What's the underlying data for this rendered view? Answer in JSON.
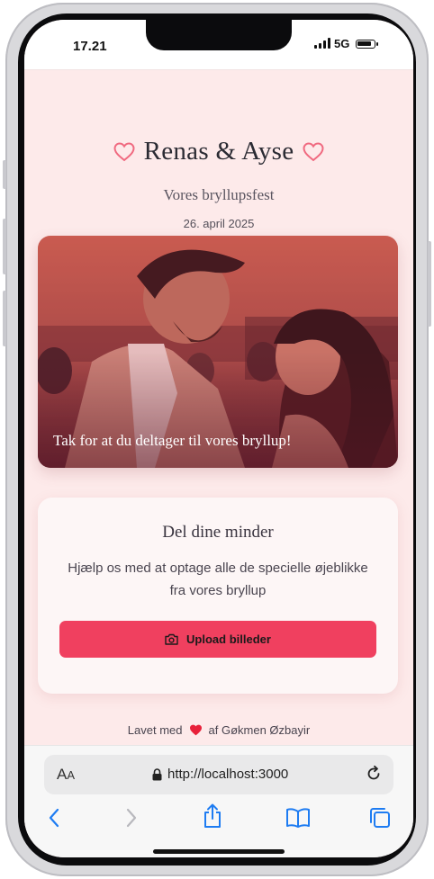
{
  "status_bar": {
    "time": "17.21",
    "network": "5G"
  },
  "page": {
    "title": "Renas & Ayse",
    "subtitle": "Vores bryllupsfest",
    "date": "26. april 2025",
    "photo_caption": "Tak for at du deltager til vores bryllup!"
  },
  "card": {
    "title": "Del dine minder",
    "text": "Hjælp os med at optage alle de specielle øjeblikke fra vores bryllup",
    "button_label": "Upload billeder"
  },
  "footer": {
    "prefix": "Lavet med",
    "suffix": "af Gøkmen Øzbayir"
  },
  "browser": {
    "text_size": "AA",
    "url": "http://localhost:3000"
  },
  "colors": {
    "accent": "#f0405f",
    "heart_outline": "#f06a80",
    "background": "#fdeaea"
  },
  "icons": [
    "heart-outline-icon",
    "camera-icon",
    "heart-icon",
    "lock-icon",
    "reload-icon",
    "back-icon",
    "forward-icon",
    "share-icon",
    "bookmarks-icon",
    "tabs-icon"
  ]
}
